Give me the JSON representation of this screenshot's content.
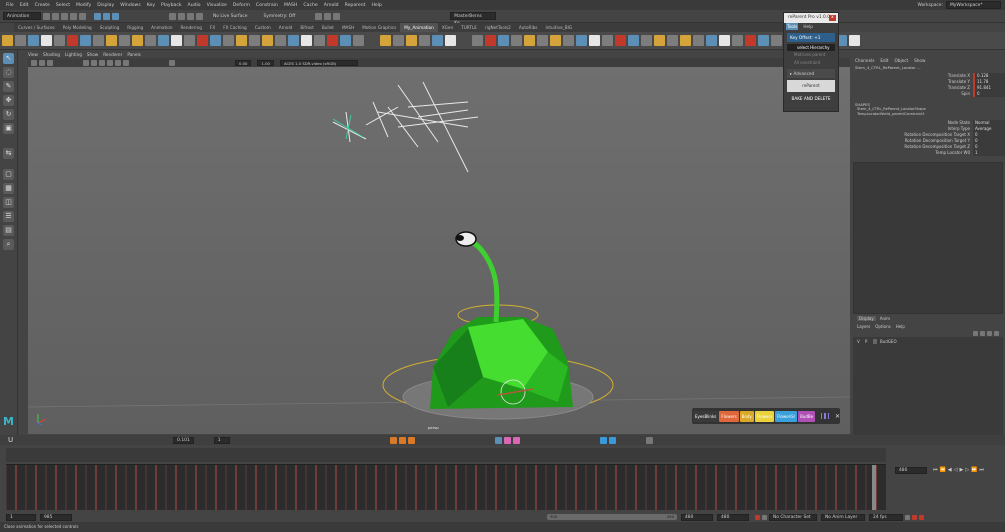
{
  "main_menu": [
    "File",
    "Edit",
    "Create",
    "Select",
    "Modify",
    "Display",
    "Windows",
    "Key",
    "Playback",
    "Audio",
    "Visualize",
    "Deform",
    "Constrain",
    "MASH",
    "Cache",
    "Arnold",
    "Reparent",
    "Help"
  ],
  "workspace": {
    "label": "Workspace:",
    "value": "MyWorkspace*"
  },
  "status_line": {
    "mode": "Animation",
    "live_surface": "No Live Surface",
    "symmetry": "Symmetry: Off",
    "render": "MasterBerns Ke..."
  },
  "shelf_tabs": [
    "Curves / Surfaces",
    "Poly Modeling",
    "Sculpting",
    "Rigging",
    "Animation",
    "Rendering",
    "FX",
    "FX Caching",
    "Custom",
    "Arnold",
    "Bifrost",
    "Bullet",
    "MASH",
    "Motion Graphics",
    "My_Animation",
    "XGen",
    "TURTLE",
    "rigNetTools2",
    "AutoRibs",
    "Intuitive_BIG"
  ],
  "shelf_active": "My_Animation",
  "viewport_menu": [
    "View",
    "Shading",
    "Lighting",
    "Show",
    "Renderer",
    "Panels"
  ],
  "viewport_toolbar": {
    "exposure": "0.00",
    "gamma": "1.00",
    "colorspace": "ACES 1.0 SDR-video (sRGB)"
  },
  "camera_label": "persp",
  "reparent": {
    "title": "reParent Pro v1.0.0",
    "close": "x",
    "menu": [
      "Tools",
      "Help"
    ],
    "key_offset": "Key Offset: +1",
    "select_hierarchy": "select Hierarchy",
    "dim_items": [
      "Matrixes parent",
      "All constraint"
    ],
    "advanced": "Advanced",
    "reparent_button": "reParent",
    "bake_button": "BAKE AND DELETE"
  },
  "channel_box": {
    "menu": [
      "Channels",
      "Edit",
      "Object",
      "Show"
    ],
    "object": "Stem_4_CTRL_ReParent_Locator ...",
    "channels": [
      {
        "name": "Translate X",
        "value": "0.128"
      },
      {
        "name": "Translate Y",
        "value": "11.78"
      },
      {
        "name": "Translate Z",
        "value": "91.841"
      },
      {
        "name": "Spin",
        "value": "0"
      }
    ],
    "shapes_label": "SHAPES",
    "shapes": [
      "Stem_4_CTRL_ReParent_LocatorShape",
      "TempLocatorWorld_parentConstraint1"
    ],
    "attrs": [
      {
        "name": "Node State",
        "value": "Normal"
      },
      {
        "name": "Interp Type",
        "value": "Average"
      },
      {
        "name": "Rotation Decomposition Target X",
        "value": "0"
      },
      {
        "name": "Rotation Decomposition Target Y",
        "value": "0"
      },
      {
        "name": "Rotation Decomposition Target Z",
        "value": "0"
      },
      {
        "name": "Temp Locator W0",
        "value": "1"
      }
    ]
  },
  "layer_editor": {
    "tabs": [
      "Display",
      "Anim"
    ],
    "menu": [
      "Layers",
      "Options",
      "Help"
    ],
    "layer": {
      "v": "V",
      "p": "P",
      "name": "BudGEO"
    }
  },
  "quick_buttons": [
    {
      "label": "EyesBlinks",
      "color": "#3a3a3a"
    },
    {
      "label": "Flowers",
      "color": "#e0673a"
    },
    {
      "label": "Body",
      "color": "#d9a928"
    },
    {
      "label": "Flowers",
      "color": "#e9d23a"
    },
    {
      "label": "FlowerGr",
      "color": "#3aa0d9"
    },
    {
      "label": "BudBe",
      "color": "#b04fb5"
    }
  ],
  "anim_toolbar": {
    "value1": "0.101",
    "value2": "1"
  },
  "time": {
    "current": "480",
    "range_start": "1",
    "range_min": "985",
    "anim_start": "300",
    "anim_end": "490",
    "range_end": "480",
    "range_end2": "480",
    "character_set": "No Character Set",
    "anim_layer": "No Anim Layer",
    "fps": "24 fps"
  },
  "help_line": "Close animation for selected controls"
}
